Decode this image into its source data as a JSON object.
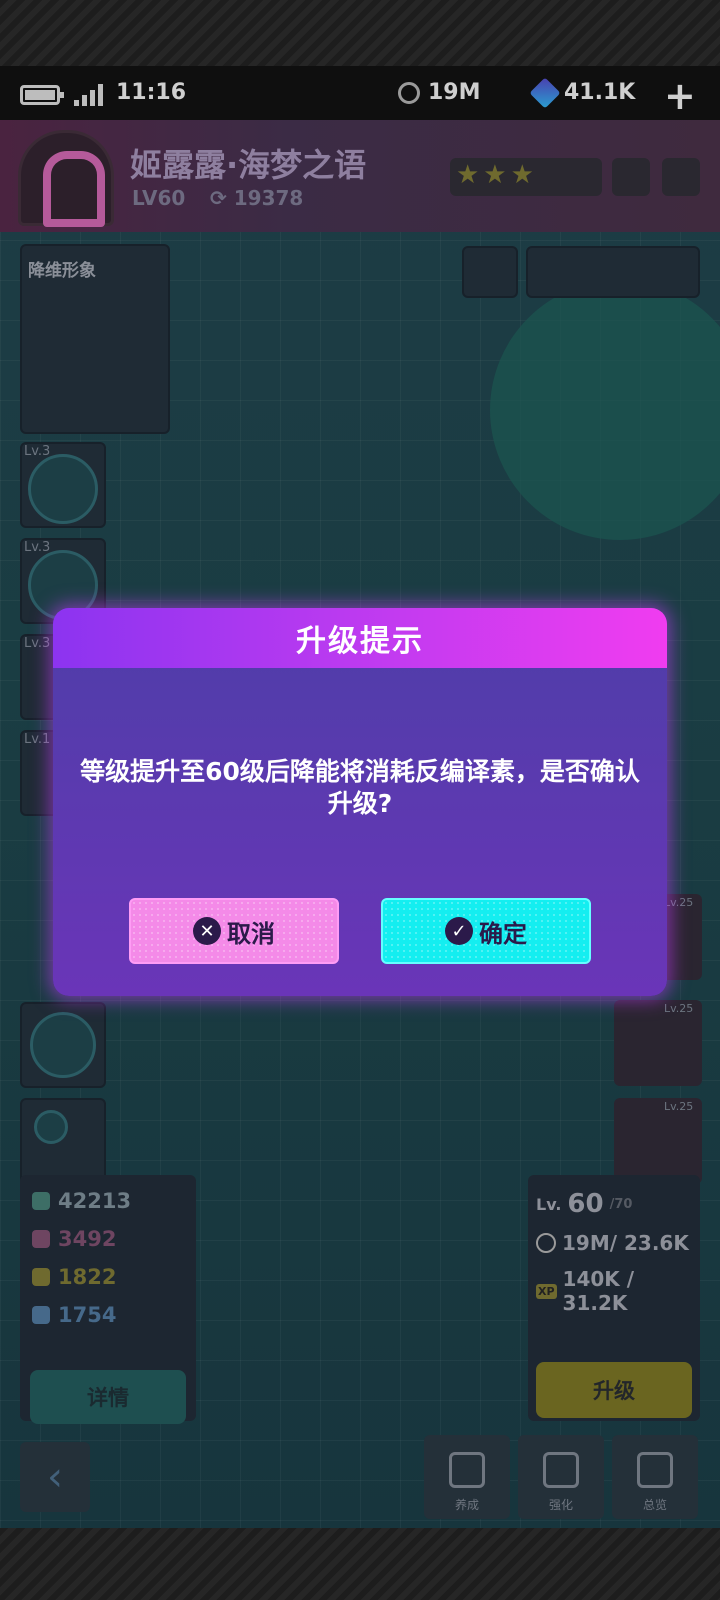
{
  "status_bar": {
    "time": "11:16",
    "currency_coin": "19M",
    "currency_gem": "41.1K",
    "add_icon": "plus-icon"
  },
  "character": {
    "name": "姬露露·海梦之语",
    "level": "LV60",
    "power": "19378",
    "stars": "★★★"
  },
  "side": {
    "title": "降维形象",
    "skills": [
      {
        "level": "Lv.3"
      },
      {
        "level": "Lv.3"
      },
      {
        "level": "Lv.3"
      },
      {
        "level": "Lv.1"
      }
    ]
  },
  "equipment": [
    {
      "level": "Lv.25"
    },
    {
      "level": "Lv.25"
    },
    {
      "level": "Lv.25"
    }
  ],
  "stats": {
    "hp": "42213",
    "atk": "3492",
    "def": "1822",
    "spd": "1754",
    "detail_label": "详情"
  },
  "upgrade": {
    "lv_label": "Lv.",
    "lv_value": "60",
    "lv_max": "/70",
    "coin_cost": "19M/ 23.6K",
    "xp_cost": "140K / 31.2K",
    "button_label": "升级"
  },
  "bottom_nav": [
    {
      "label": "养成",
      "icon": "heart-icon"
    },
    {
      "label": "强化",
      "icon": "chip-icon"
    },
    {
      "label": "总览",
      "icon": "folder-icon"
    }
  ],
  "dialog": {
    "title": "升级提示",
    "message": "等级提升至60级后降能将消耗反编译素，是否确认升级?",
    "cancel_label": "取消",
    "confirm_label": "确定"
  }
}
